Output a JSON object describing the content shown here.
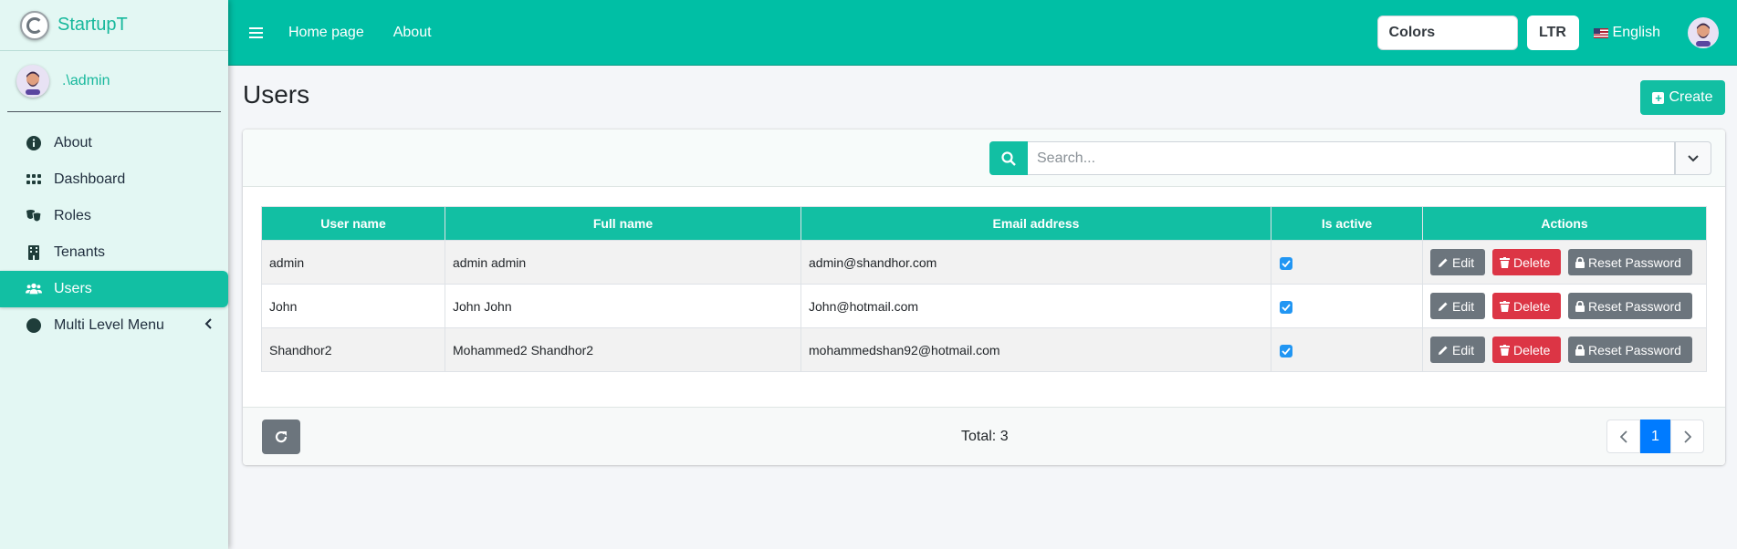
{
  "brand": {
    "name": "StartupT"
  },
  "user_panel": {
    "name": ".\\admin"
  },
  "sidebar": {
    "items": [
      {
        "label": "About",
        "icon": "info-circle-icon"
      },
      {
        "label": "Dashboard",
        "icon": "grid-icon"
      },
      {
        "label": "Roles",
        "icon": "theater-masks-icon"
      },
      {
        "label": "Tenants",
        "icon": "building-icon"
      },
      {
        "label": "Users",
        "icon": "users-icon",
        "active": true
      },
      {
        "label": "Multi Level Menu",
        "icon": "circle-icon"
      }
    ]
  },
  "topbar": {
    "links": [
      "Home page",
      "About"
    ],
    "colors_select": "Colors",
    "direction_button": "LTR",
    "language": "English"
  },
  "page": {
    "title": "Users",
    "create_label": "Create"
  },
  "search": {
    "placeholder": "Search..."
  },
  "table": {
    "columns": [
      "User name",
      "Full name",
      "Email address",
      "Is active",
      "Actions"
    ],
    "rows": [
      {
        "user_name": "admin",
        "full_name": "admin admin",
        "email": "admin@shandhor.com",
        "is_active": true
      },
      {
        "user_name": "John",
        "full_name": "John John",
        "email": "John@hotmail.com",
        "is_active": true
      },
      {
        "user_name": "Shandhor2",
        "full_name": "Mohammed2 Shandhor2",
        "email": "mohammedshan92@hotmail.com",
        "is_active": true
      }
    ],
    "actions": {
      "edit": "Edit",
      "delete": "Delete",
      "reset": "Reset Password"
    }
  },
  "footer": {
    "total": "Total: 3",
    "current_page": "1"
  },
  "colors": {
    "accent": "#00bfa5",
    "danger": "#dc3545",
    "secondary": "#6c757d",
    "primary": "#007bff"
  }
}
